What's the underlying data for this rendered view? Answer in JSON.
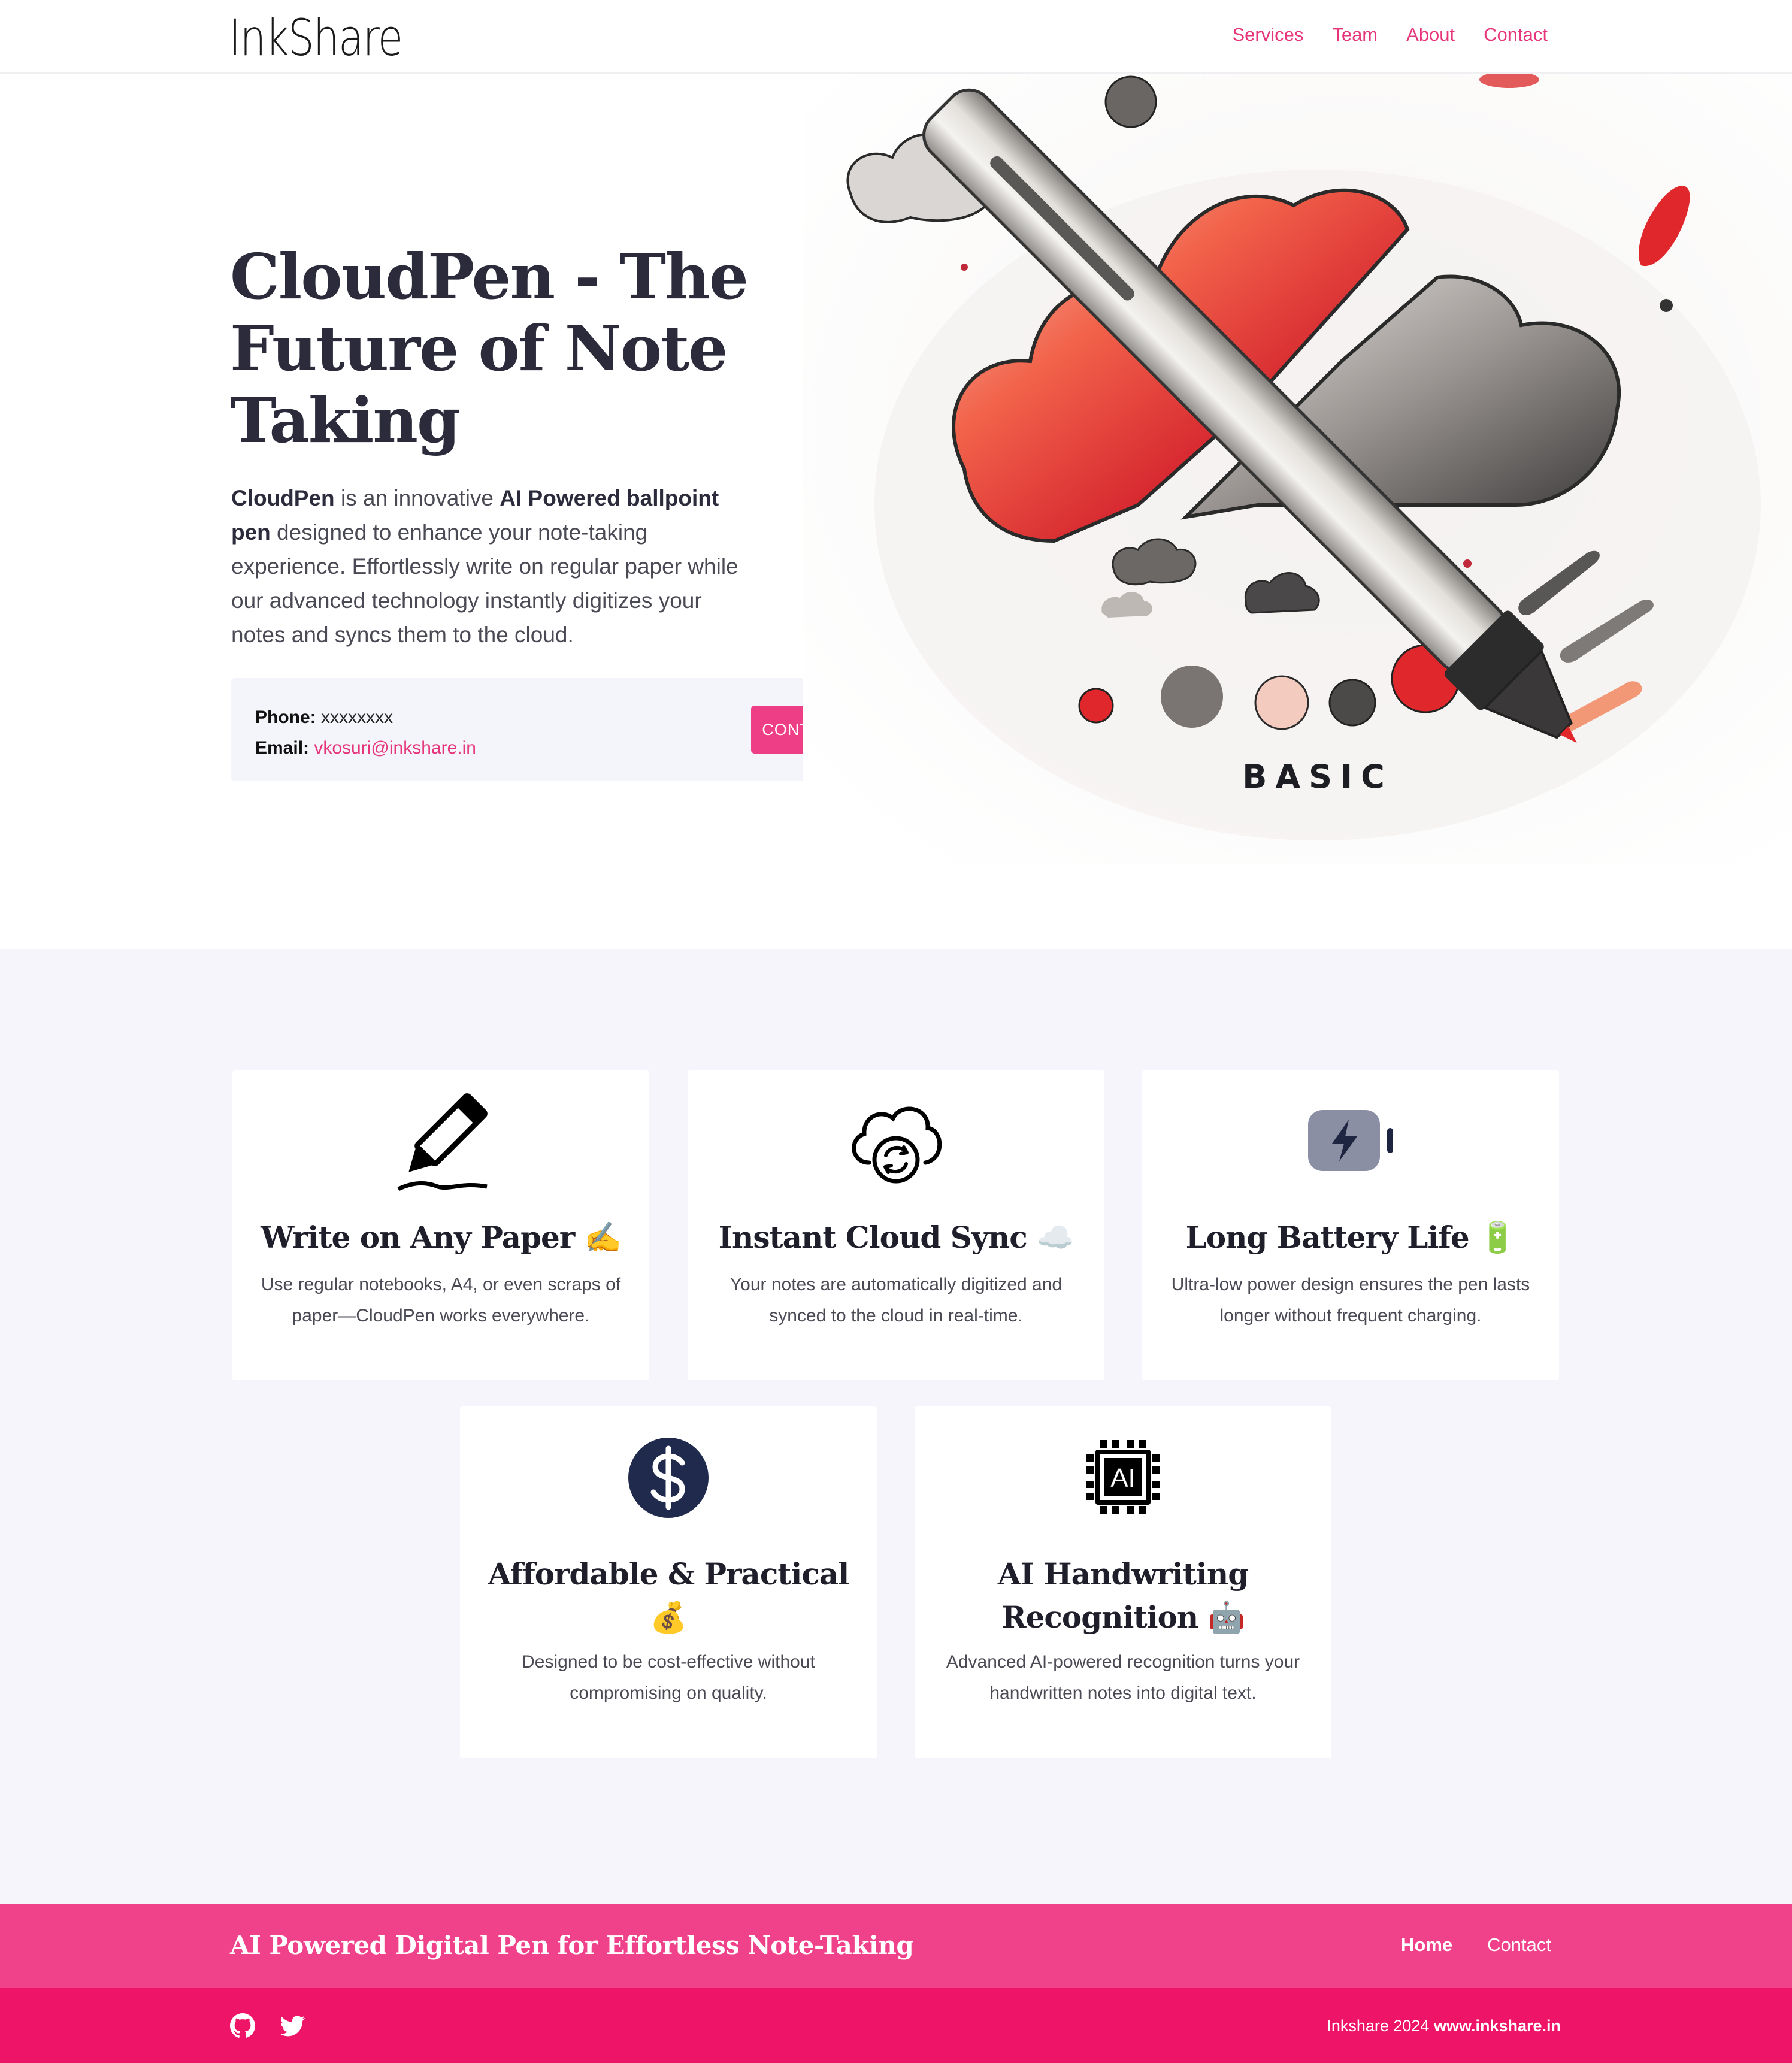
{
  "header": {
    "logo": "InkShare",
    "nav": [
      "Services",
      "Team",
      "About",
      "Contact"
    ]
  },
  "hero": {
    "title": "CloudPen - The Future of Note Taking",
    "desc_brand": "CloudPen",
    "desc_part1": " is an innovative ",
    "desc_bold": "AI Powered ballpoint pen",
    "desc_part2": " designed to enhance your note-taking experience. Effortlessly write on regular paper while our advanced technology instantly digitizes your notes and syncs them to the cloud.",
    "phone_label": "Phone:",
    "phone_value": " xxxxxxxx",
    "email_label": "Email:",
    "email_value": "vkosuri@inkshare.in",
    "contact_button": "CONTACT",
    "image_caption": "BASIC"
  },
  "features": [
    {
      "icon": "pencil-icon",
      "title": "Write on Any Paper ✍️",
      "text": "Use regular notebooks, A4, or even scraps of paper—CloudPen works everywhere."
    },
    {
      "icon": "cloud-sync-icon",
      "title": "Instant Cloud Sync ☁️",
      "text": "Your notes are automatically digitized and synced to the cloud in real-time."
    },
    {
      "icon": "battery-charging-icon",
      "title": "Long Battery Life 🔋",
      "text": "Ultra-low power design ensures the pen lasts longer without frequent charging."
    },
    {
      "icon": "dollar-icon",
      "title": "Affordable & Practical 💰",
      "text": "Designed to be cost-effective without compromising on quality."
    },
    {
      "icon": "ai-chip-icon",
      "title": "AI Handwriting Recognition 🤖",
      "text": "Advanced AI-powered recognition turns your handwritten notes into digital text."
    }
  ],
  "footer": {
    "tagline": "AI Powered Digital Pen for Effortless Note-Taking",
    "nav": [
      "Home",
      "Contact"
    ],
    "copyright_prefix": "Inkshare 2024 ",
    "copyright_site": "www.inkshare.in",
    "social": [
      "github-icon",
      "twitter-icon"
    ]
  },
  "colors": {
    "accent": "#ee3e85",
    "footer_top": "#f0428a",
    "footer_bottom": "#ee1467",
    "features_bg": "#f5f5fb"
  }
}
